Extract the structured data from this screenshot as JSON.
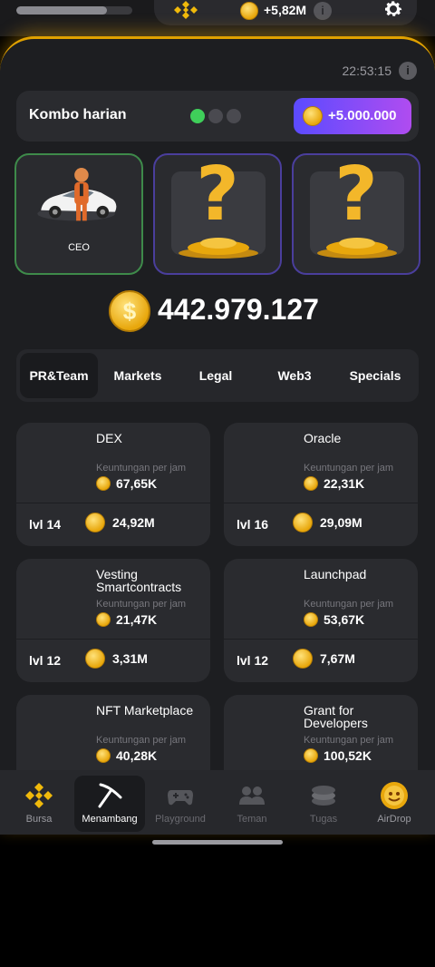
{
  "top": {
    "progress": 0.78,
    "profit": "+5,82M",
    "info": "i",
    "icons": [
      "binance-icon",
      "coin-icon",
      "info-icon",
      "gear-icon"
    ]
  },
  "timer": {
    "time": "22:53:15",
    "info": "i"
  },
  "kombo": {
    "title": "Kombo harian",
    "reward": "+5.000.000",
    "found": 1,
    "total": 3
  },
  "combo_cards": [
    {
      "label": "CEO",
      "state": "found"
    },
    {
      "label": "",
      "state": "hidden"
    },
    {
      "label": "",
      "state": "hidden"
    }
  ],
  "balance": {
    "symbol": "$",
    "value": "442.979.127"
  },
  "tabs": [
    "PR&Team",
    "Markets",
    "Legal",
    "Web3",
    "Specials"
  ],
  "active_tab": "PR&Team",
  "cards": [
    {
      "name": "DEX",
      "sub": "Keuntungan per jam",
      "pph": "67,65K",
      "lvl": "lvl 14",
      "cost": "24,92M"
    },
    {
      "name": "Oracle",
      "sub": "Keuntungan per jam",
      "pph": "22,31K",
      "lvl": "lvl 16",
      "cost": "29,09M"
    },
    {
      "name": "Vesting Smartcontracts",
      "sub": "Keuntungan per jam",
      "pph": "21,47K",
      "lvl": "lvl 12",
      "cost": "3,31M"
    },
    {
      "name": "Launchpad",
      "sub": "Keuntungan per jam",
      "pph": "53,67K",
      "lvl": "lvl 12",
      "cost": "7,67M"
    },
    {
      "name": "NFT Marketplace",
      "sub": "Keuntungan per jam",
      "pph": "40,28K"
    },
    {
      "name": "Grant for Developers",
      "sub": "Keuntungan per jam",
      "pph": "100,52K"
    }
  ],
  "nav": [
    {
      "label": "Bursa",
      "icon": "binance-icon"
    },
    {
      "label": "Menambang",
      "icon": "pickaxe-icon"
    },
    {
      "label": "Playground",
      "icon": "gamepad-icon"
    },
    {
      "label": "Teman",
      "icon": "friends-icon"
    },
    {
      "label": "Tugas",
      "icon": "tasks-icon"
    },
    {
      "label": "AirDrop",
      "icon": "airdrop-icon"
    }
  ],
  "colors": {
    "accent": "#e0a100",
    "reward_from": "#5b4bff",
    "reward_to": "#b04cf0",
    "found_dot": "#3fcf5a"
  }
}
